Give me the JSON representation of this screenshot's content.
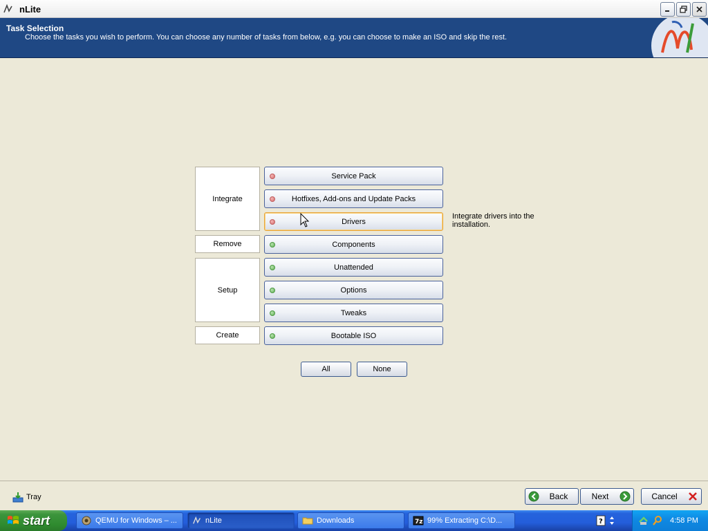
{
  "window": {
    "title": "nLite"
  },
  "header": {
    "title": "Task Selection",
    "subtitle": "Choose the tasks you wish to perform. You can choose any number of tasks from below, e.g. you can choose to make an ISO and skip the rest."
  },
  "groups": {
    "integrate": "Integrate",
    "remove": "Remove",
    "setup": "Setup",
    "create": "Create"
  },
  "tasks": [
    {
      "label": "Service Pack",
      "status": "red"
    },
    {
      "label": "Hotfixes, Add-ons and Update Packs",
      "status": "red"
    },
    {
      "label": "Drivers",
      "status": "red"
    },
    {
      "label": "Components",
      "status": "green"
    },
    {
      "label": "Unattended",
      "status": "green"
    },
    {
      "label": "Options",
      "status": "green"
    },
    {
      "label": "Tweaks",
      "status": "green"
    },
    {
      "label": "Bootable ISO",
      "status": "green"
    }
  ],
  "hover_description": "Integrate drivers into the installation.",
  "selection": {
    "all": "All",
    "none": "None"
  },
  "footer": {
    "tray": "Tray",
    "back": "Back",
    "next": "Next",
    "cancel": "Cancel"
  },
  "taskbar": {
    "start": "start",
    "items": [
      {
        "label": "QEMU for Windows – ..."
      },
      {
        "label": "nLite"
      },
      {
        "label": "Downloads"
      },
      {
        "label": "99% Extracting C:\\D..."
      }
    ],
    "clock": "4:58 PM"
  },
  "colors": {
    "header_bg": "#1f4884",
    "dialog_bg": "#ECE9D8",
    "status_red": "#d56a6a",
    "status_green": "#5fb052",
    "taskbar": "#245edb",
    "start_green": "#3c943c"
  }
}
